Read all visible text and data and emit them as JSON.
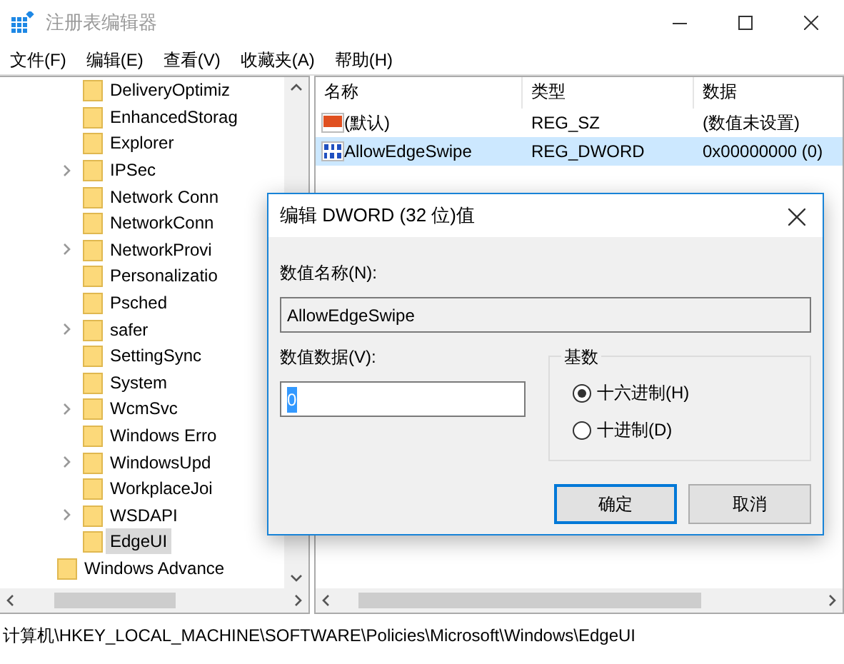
{
  "window": {
    "title": "注册表编辑器"
  },
  "menu": [
    "文件(F)",
    "编辑(E)",
    "查看(V)",
    "收藏夹(A)",
    "帮助(H)"
  ],
  "tree": [
    {
      "children": [
        {
          "label": "DeliveryOptimiz",
          "expandable": false,
          "selected": false
        },
        {
          "label": "EnhancedStorag",
          "expandable": false,
          "selected": false
        },
        {
          "label": "Explorer",
          "expandable": false,
          "selected": false
        },
        {
          "label": "IPSec",
          "expandable": true,
          "selected": false
        },
        {
          "label": "Network Conn",
          "expandable": false,
          "selected": false
        },
        {
          "label": "NetworkConn",
          "expandable": false,
          "selected": false
        },
        {
          "label": "NetworkProvi",
          "expandable": true,
          "selected": false
        },
        {
          "label": "Personalizatio",
          "expandable": false,
          "selected": false
        },
        {
          "label": "Psched",
          "expandable": false,
          "selected": false
        },
        {
          "label": "safer",
          "expandable": true,
          "selected": false
        },
        {
          "label": "SettingSync",
          "expandable": false,
          "selected": false
        },
        {
          "label": "System",
          "expandable": false,
          "selected": false
        },
        {
          "label": "WcmSvc",
          "expandable": true,
          "selected": false
        },
        {
          "label": "Windows Erro",
          "expandable": false,
          "selected": false
        },
        {
          "label": "WindowsUpd",
          "expandable": true,
          "selected": false
        },
        {
          "label": "WorkplaceJoi",
          "expandable": false,
          "selected": false
        },
        {
          "label": "WSDAPI",
          "expandable": true,
          "selected": false
        },
        {
          "label": "EdgeUI",
          "expandable": false,
          "selected": true
        }
      ]
    },
    {
      "label": "Windows Advance",
      "expandable": false,
      "selected": false
    }
  ],
  "values": {
    "columns": [
      "名称",
      "类型",
      "数据"
    ],
    "rows": [
      {
        "kind": "string",
        "name": "(默认)",
        "type": "REG_SZ",
        "data": "(数值未设置)",
        "selected": false
      },
      {
        "kind": "binary",
        "name": "AllowEdgeSwipe",
        "type": "REG_DWORD",
        "data": "0x00000000 (0)",
        "selected": true
      }
    ]
  },
  "dialog": {
    "title": "编辑 DWORD (32 位)值",
    "name_label": "数值名称(N):",
    "name_value": "AllowEdgeSwipe",
    "data_label": "数值数据(V):",
    "data_value": "0",
    "base_label": "基数",
    "radios": [
      {
        "label": "十六进制(H)",
        "selected": true
      },
      {
        "label": "十进制(D)",
        "selected": false
      }
    ],
    "buttons": [
      {
        "label": "确定",
        "default": true
      },
      {
        "label": "取消",
        "default": false
      }
    ]
  },
  "status_bar": "计算机\\HKEY_LOCAL_MACHINE\\SOFTWARE\\Policies\\Microsoft\\Windows\\EdgeUI"
}
